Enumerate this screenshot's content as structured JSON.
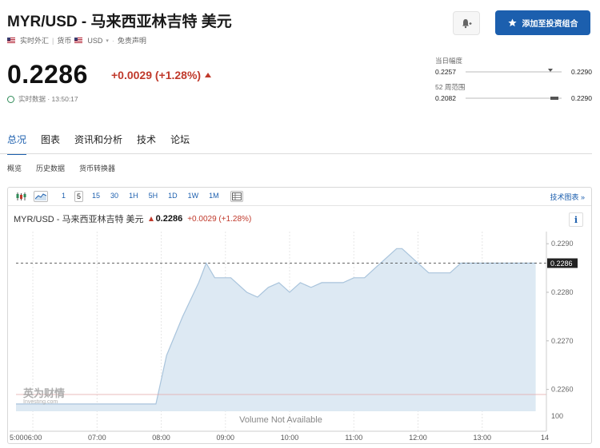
{
  "header": {
    "title": "MYR/USD - 马来西亚林吉特 美元",
    "realtime_fx": "实时外汇",
    "currency_label": "货币",
    "currency": "USD",
    "disclaimer": "免责声明",
    "add_portfolio_label": "添加至投资组合"
  },
  "quote": {
    "price": "0.2286",
    "change": "+0.0029 (+1.28%)",
    "realtime_data": "实时数据 · 13:50:17"
  },
  "ranges": {
    "day_label": "当日幅度",
    "day_low": "0.2257",
    "day_high": "0.2290",
    "day_position": 0.88,
    "week52_label": "52 周范围",
    "week52_low": "0.2082",
    "week52_high": "0.2290",
    "week52_position": 0.97
  },
  "tabs": [
    "总况",
    "图表",
    "资讯和分析",
    "技术",
    "论坛"
  ],
  "subtabs": [
    "概览",
    "历史数据",
    "货币转换器"
  ],
  "toolbar": {
    "intervals": [
      "1",
      "5",
      "15",
      "30",
      "1H",
      "5H",
      "1D",
      "1W",
      "1M"
    ],
    "selected_interval": "5",
    "advanced_chart": "技术图表 »"
  },
  "chart_header": {
    "symbol": "MYR/USD - 马来西亚林吉特 美元",
    "price": "0.2286",
    "change": "+0.0029 (+1.28%)"
  },
  "watermark": {
    "cn": "英为财情",
    "en": "Investing.com"
  },
  "volume_note": "Volume Not Available",
  "colors": {
    "accent": "#1c5fae",
    "down_red": "#c0392b",
    "area_fill": "#dde9f3",
    "line": "#a9c4dc"
  },
  "chart_data": {
    "type": "area",
    "x": [
      "06:00",
      "06:30",
      "07:00",
      "07:30",
      "07:55",
      "08:05",
      "08:20",
      "08:35",
      "08:42",
      "08:50",
      "09:05",
      "09:20",
      "09:30",
      "09:40",
      "09:50",
      "10:00",
      "10:10",
      "10:20",
      "10:30",
      "10:40",
      "10:50",
      "11:00",
      "11:10",
      "11:20",
      "11:30",
      "11:40",
      "11:45",
      "11:55",
      "12:10",
      "12:30",
      "12:40",
      "13:00",
      "13:30",
      "13:50"
    ],
    "y": [
      0.2257,
      0.2257,
      0.2257,
      0.2257,
      0.2257,
      0.2267,
      0.2275,
      0.2282,
      0.2286,
      0.2283,
      0.2283,
      0.228,
      0.2279,
      0.2281,
      0.2282,
      0.228,
      0.2282,
      0.2281,
      0.2282,
      0.2282,
      0.2282,
      0.2283,
      0.2283,
      0.2285,
      0.2287,
      0.2289,
      0.2289,
      0.2287,
      0.2284,
      0.2284,
      0.2286,
      0.2286,
      0.2286,
      0.2286
    ],
    "xticks": [
      "06:00",
      "07:00",
      "08:00",
      "09:00",
      "10:00",
      "11:00",
      "12:00",
      "13:00",
      "14"
    ],
    "yticks": [
      "0.2290",
      "0.2280",
      "0.2270",
      "0.2260"
    ],
    "ylim": [
      0.22555,
      0.22925
    ],
    "current_value": "0.2286",
    "volume_axis_label": "100"
  }
}
